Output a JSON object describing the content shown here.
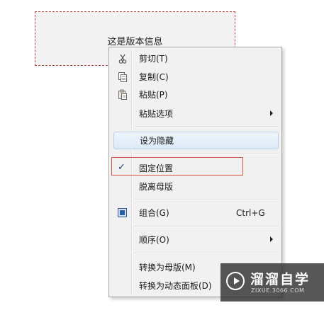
{
  "textbox": {
    "text": "这是版本信息"
  },
  "menu": {
    "items": [
      {
        "label": "剪切(T)",
        "icon": "scissors-icon"
      },
      {
        "label": "复制(C)",
        "icon": "copy-icon"
      },
      {
        "label": "粘贴(P)",
        "icon": "paste-icon"
      },
      {
        "label": "粘贴选项",
        "submenu": true
      },
      {
        "label": "设为隐藏",
        "hovered": true
      },
      {
        "label": "固定位置",
        "checked": true,
        "check_glyph": "✓"
      },
      {
        "label": "脱离母版"
      },
      {
        "label": "组合(G)",
        "shortcut": "Ctrl+G",
        "icon": "group-icon"
      },
      {
        "label": "顺序(O)",
        "submenu": true
      },
      {
        "label": "转换为母版(M)"
      },
      {
        "label": "转换为动态面板(D)"
      }
    ]
  },
  "colors": {
    "highlight_border": "#cf5a4a",
    "hover_bg": "#dce9f7",
    "textbox_border": "#b04848"
  },
  "watermark": {
    "title": "溜溜自学",
    "subtitle": "ZIXUE.3066.COM"
  }
}
